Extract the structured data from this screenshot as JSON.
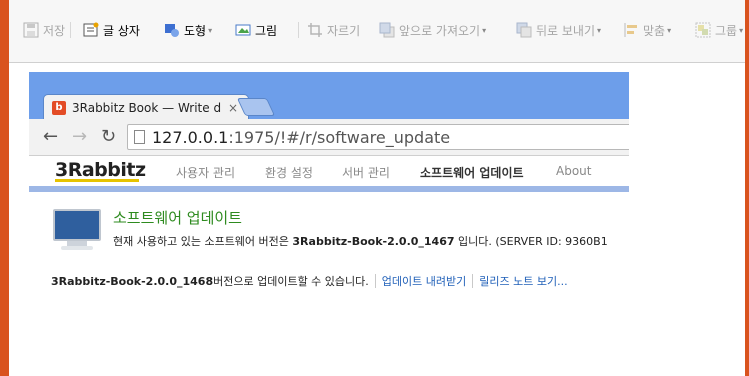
{
  "editor_toolbar": {
    "items": [
      {
        "label": "저장",
        "icon": "save-icon",
        "disabled": true
      },
      {
        "label": "글 상자",
        "icon": "textbox-icon",
        "disabled": false
      },
      {
        "label": "도형",
        "icon": "shape-icon",
        "disabled": false,
        "dropdown": true
      },
      {
        "label": "그림",
        "icon": "image-icon",
        "disabled": false
      },
      {
        "label": "자르기",
        "icon": "crop-icon",
        "disabled": true
      },
      {
        "label": "앞으로 가져오기",
        "icon": "bring-forward-icon",
        "disabled": true,
        "dropdown": true
      },
      {
        "label": "뒤로 보내기",
        "icon": "send-backward-icon",
        "disabled": true,
        "dropdown": true
      },
      {
        "label": "맞춤",
        "icon": "align-icon",
        "disabled": true,
        "dropdown": true
      },
      {
        "label": "그룹",
        "icon": "group-icon",
        "disabled": true,
        "dropdown": true
      }
    ]
  },
  "browser": {
    "tab_title": "3Rabbitz Book — Write d",
    "favicon_letter": "b",
    "tab_close": "×",
    "url_host": "127.0.0.1",
    "url_rest": ":1975/!#/r/software_update"
  },
  "app_nav": {
    "logo": "3Rabbitz",
    "items": [
      {
        "label": "사용자 관리",
        "active": false
      },
      {
        "label": "환경 설정",
        "active": false
      },
      {
        "label": "서버 관리",
        "active": false
      },
      {
        "label": "소프트웨어 업데이트",
        "active": true
      },
      {
        "label": "About",
        "active": false
      }
    ]
  },
  "content": {
    "title": "소프트웨어 업데이트",
    "desc_prefix": "현재 사용하고 있는 소프트웨어 버전은 ",
    "current_version": "3Rabbitz-Book-2.0.0_1467",
    "desc_suffix": " 입니다. (SERVER ID: 9360B1",
    "new_version": "3Rabbitz-Book-2.0.0_1468",
    "update_text": " 버전으로 업데이트할 수 있습니다.",
    "download_link": "업데이트 내려받기",
    "release_notes_link": "릴리즈 노트 보기..."
  },
  "colors": {
    "frame_orange": "#d9531e",
    "chrome_blue": "#6d9eea",
    "title_green": "#2e8b1f",
    "link_blue": "#1f5fb8"
  }
}
